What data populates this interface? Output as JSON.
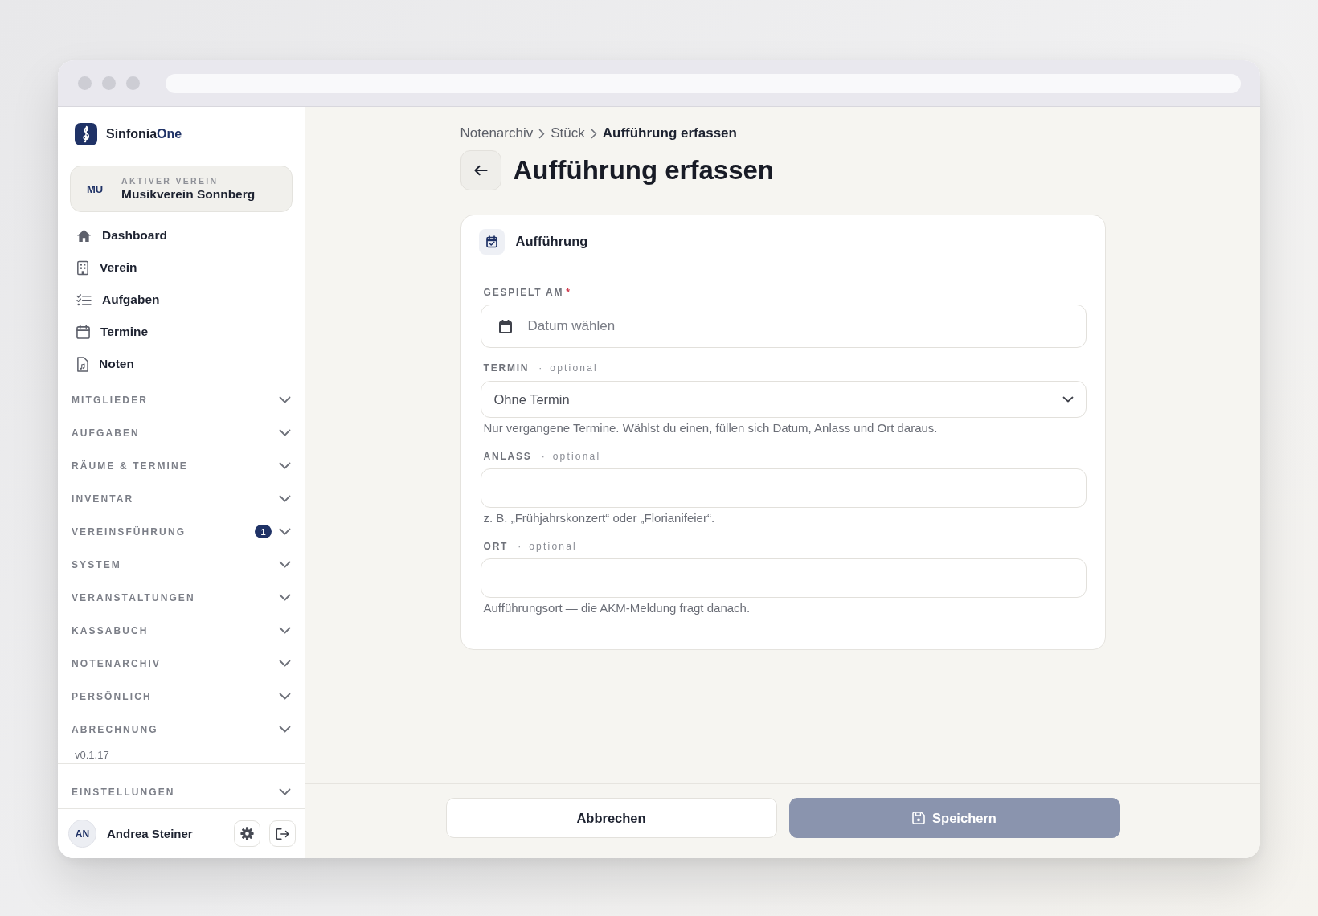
{
  "sidebar": {
    "brand": {
      "name": "Sinfonia",
      "accent": "One"
    },
    "active_club": {
      "initials": "MU",
      "caption": "AKTIVER VEREIN",
      "name": "Musikverein Sonnberg"
    },
    "nav": [
      {
        "label": "Dashboard",
        "kind": "home",
        "selected": false
      },
      {
        "label": "Verein",
        "kind": "building",
        "selected": false
      },
      {
        "label": "Aufgaben",
        "kind": "tasks",
        "selected": false
      },
      {
        "label": "Termine",
        "kind": "calendar",
        "selected": false
      },
      {
        "label": "Noten",
        "kind": "document",
        "selected": false
      }
    ],
    "sections": [
      {
        "label": "MITGLIEDER",
        "expanded": false
      },
      {
        "label": "AUFGABEN",
        "expanded": false
      },
      {
        "label": "RÄUME & TERMINE",
        "expanded": false
      },
      {
        "label": "INVENTAR",
        "expanded": false
      },
      {
        "label": "VEREINSFÜHRUNG",
        "expanded": false,
        "badge": "1"
      },
      {
        "label": "SYSTEM",
        "expanded": false
      },
      {
        "label": "VERANSTALTUNGEN",
        "expanded": false
      },
      {
        "label": "KASSABUCH",
        "expanded": false
      },
      {
        "label": "NOTENARCHIV",
        "expanded": false
      },
      {
        "label": "PERSÖNLICH",
        "expanded": false
      },
      {
        "label": "ABRECHNUNG",
        "expanded": false
      }
    ],
    "version": "v0.1.17",
    "settings_section": {
      "label": "EINSTELLUNGEN",
      "expanded": false
    },
    "user": {
      "initials": "AN",
      "name": "Andrea Steiner"
    }
  },
  "main": {
    "breadcrumb": [
      {
        "label": "Notenarchiv",
        "current": false
      },
      {
        "label": "Stück",
        "current": false
      },
      {
        "label": "Aufführung erfassen",
        "current": true
      }
    ],
    "title": "Aufführung erfassen",
    "card": {
      "title": "Aufführung",
      "fields": [
        {
          "kind": "date",
          "label": "GESPIELT AM",
          "required_mark": "*",
          "placeholder": "Datum wählen"
        },
        {
          "kind": "select",
          "label": "TERMIN",
          "separator": "·",
          "note": "optional",
          "value": "Ohne Termin",
          "hint": "Nur vergangene Termine. Wählst du einen, füllen sich Datum, Anlass und Ort daraus."
        },
        {
          "kind": "text",
          "label": "ANLASS",
          "separator": "·",
          "note": "optional",
          "hint": "z. B. „Frühjahrskonzert“ oder „Florianifeier“."
        },
        {
          "kind": "text",
          "label": "ORT",
          "separator": "·",
          "note": "optional",
          "hint": "Aufführungsort — die AKM-Meldung fragt danach."
        }
      ]
    },
    "actions": [
      {
        "label": "Abbrechen",
        "kind": "secondary",
        "disabled": false
      },
      {
        "label": "Speichern",
        "kind": "primary",
        "disabled": true
      }
    ]
  }
}
